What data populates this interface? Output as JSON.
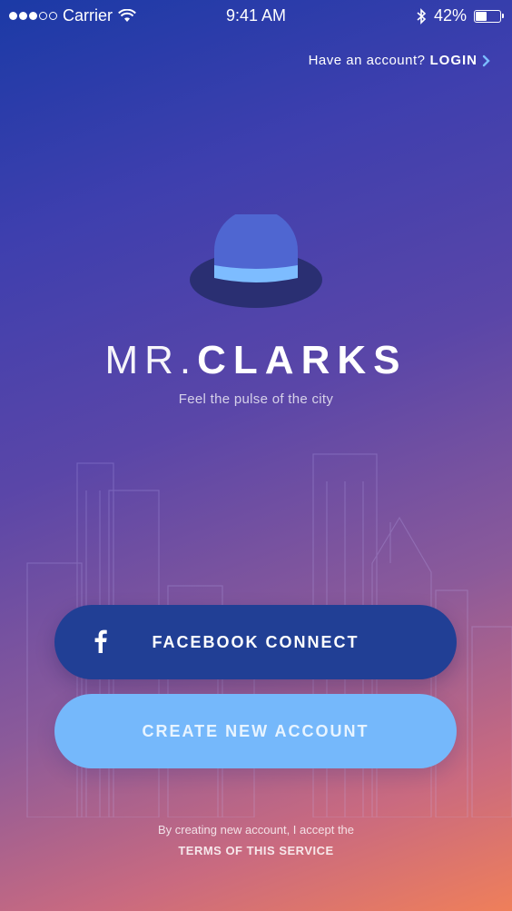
{
  "status_bar": {
    "carrier": "Carrier",
    "time": "9:41 AM",
    "battery_percent": "42%",
    "battery_level": 0.42
  },
  "header": {
    "account_prompt": "Have an account?",
    "login_label": "LOGIN"
  },
  "brand": {
    "name_light": "MR.",
    "name_bold": "CLARKS",
    "tagline": "Feel the pulse of the city"
  },
  "buttons": {
    "facebook_label": "FACEBOOK CONNECT",
    "create_label": "CREATE NEW ACCOUNT"
  },
  "terms": {
    "text": "By creating new account, I accept the",
    "link_label": "TERMS OF THIS SERVICE"
  },
  "icons": {
    "wifi": "wifi-icon",
    "bluetooth": "bluetooth-icon",
    "battery": "battery-icon",
    "chevron": "chevron-right-icon",
    "logo": "bowler-hat-icon",
    "facebook": "facebook-icon"
  },
  "colors": {
    "facebook_button": "#213f95",
    "create_button": "#75b8fb",
    "login_chevron": "#7bbdff",
    "gradient_top": "#1b3aa6",
    "gradient_bottom": "#ef7f5a"
  }
}
